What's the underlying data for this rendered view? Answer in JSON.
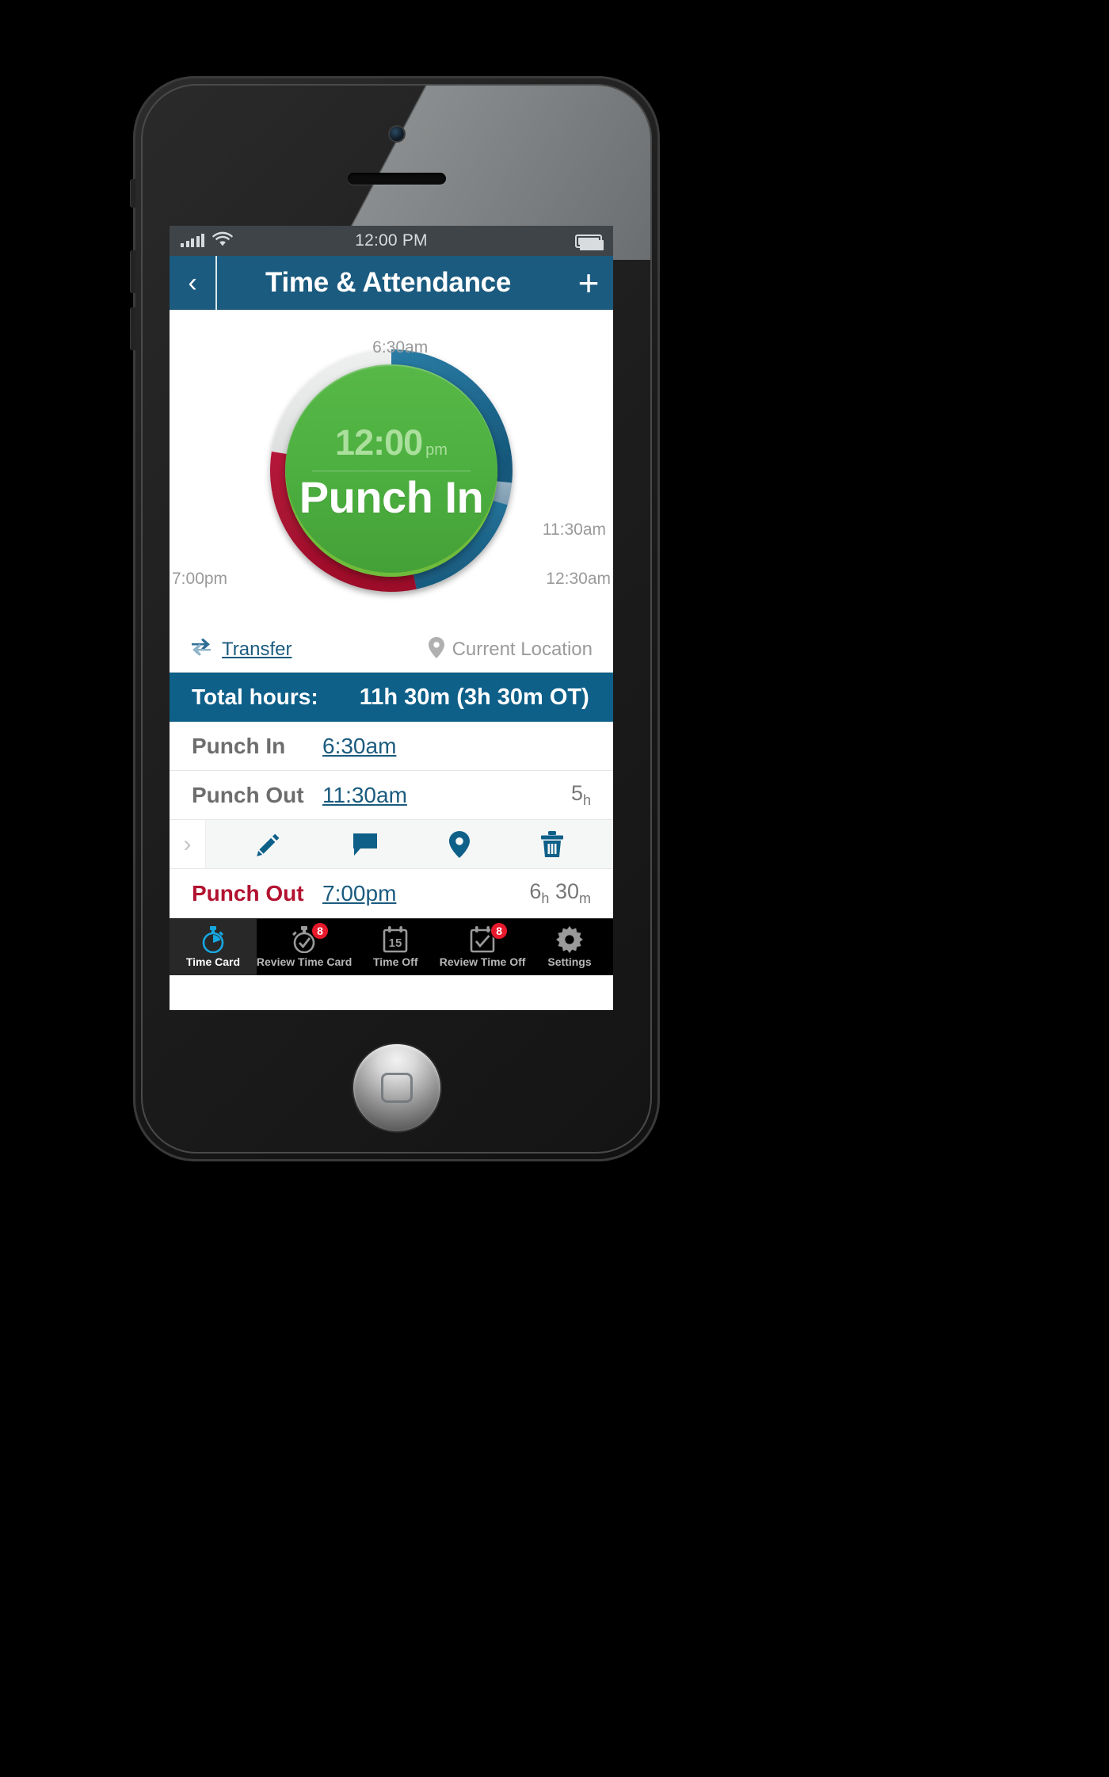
{
  "status_bar": {
    "time": "12:00 PM",
    "signal_icon": "signal-bars-icon",
    "wifi_icon": "wifi-icon",
    "battery_icon": "battery-full-icon"
  },
  "nav": {
    "back_glyph": "‹",
    "title": "Time & Attendance",
    "add_glyph": "+"
  },
  "clock": {
    "current_time": "12:00",
    "current_ampm": "pm",
    "action_label": "Punch In",
    "labels": {
      "start": "6:30am",
      "punch_out_1": "11:30am",
      "midnight": "12:30am",
      "punch_out_2": "7:00pm"
    },
    "colors": {
      "track": "#e4e6e7",
      "worked_dark_blue": "#1f6c94",
      "break_light_blue": "#8aa7bb",
      "overtime_red": "#b21230",
      "center_green": "#4caf3f"
    },
    "segments": [
      {
        "name": "worked-1",
        "from_label": "6:30am",
        "to_label": "11:30am",
        "hours": 5,
        "color": "#1f6c94"
      },
      {
        "name": "break",
        "from_label": "11:30am",
        "to_label": "12:30am",
        "hours": 1,
        "color": "#8aa7bb"
      },
      {
        "name": "worked-2",
        "from_label": "12:30am",
        "to_label": "7:00pm",
        "hours": 6.5,
        "color": "#1f6c94"
      },
      {
        "name": "overtime",
        "from_label": "7:00pm",
        "to_label": "6:30am",
        "hours": 3.5,
        "color": "#b21230"
      },
      {
        "name": "remaining",
        "hours": 8,
        "color": "#e4e6e7"
      }
    ]
  },
  "meta": {
    "transfer_label": "Transfer",
    "transfer_icon": "transfer-arrows-icon",
    "location_label": "Current Location",
    "location_icon": "map-pin-icon"
  },
  "totals": {
    "label": "Total hours:",
    "value": "11h 30m (3h 30m OT)"
  },
  "punches": [
    {
      "label": "Punch In",
      "time": "6:30am",
      "dur_h": "",
      "dur_h_unit": "",
      "dur_m": "",
      "dur_m_unit": "",
      "type": "in"
    },
    {
      "label": "Punch Out",
      "time": "11:30am",
      "dur_h": "5",
      "dur_h_unit": "h",
      "dur_m": "",
      "dur_m_unit": "",
      "type": "in"
    },
    {
      "label": "Punch Out",
      "time": "7:00pm",
      "dur_h": "6",
      "dur_h_unit": "h",
      "dur_m": "30",
      "dur_m_unit": "m",
      "type": "out"
    }
  ],
  "action_row": {
    "chevron_glyph": "›",
    "icons": [
      {
        "name": "edit-pencil-icon"
      },
      {
        "name": "comment-icon"
      },
      {
        "name": "map-pin-icon"
      },
      {
        "name": "delete-trash-icon"
      }
    ]
  },
  "tabs": [
    {
      "label": "Time Card",
      "icon": "stopwatch-icon",
      "badge": "",
      "active": true
    },
    {
      "label": "Review Time Card",
      "icon": "stopwatch-check-icon",
      "badge": "8",
      "active": false
    },
    {
      "label": "Time Off",
      "icon": "calendar-15-icon",
      "badge": "",
      "active": false
    },
    {
      "label": "Review Time Off",
      "icon": "calendar-check-icon",
      "badge": "8",
      "active": false
    },
    {
      "label": "Settings",
      "icon": "gear-icon",
      "badge": "",
      "active": false
    }
  ]
}
